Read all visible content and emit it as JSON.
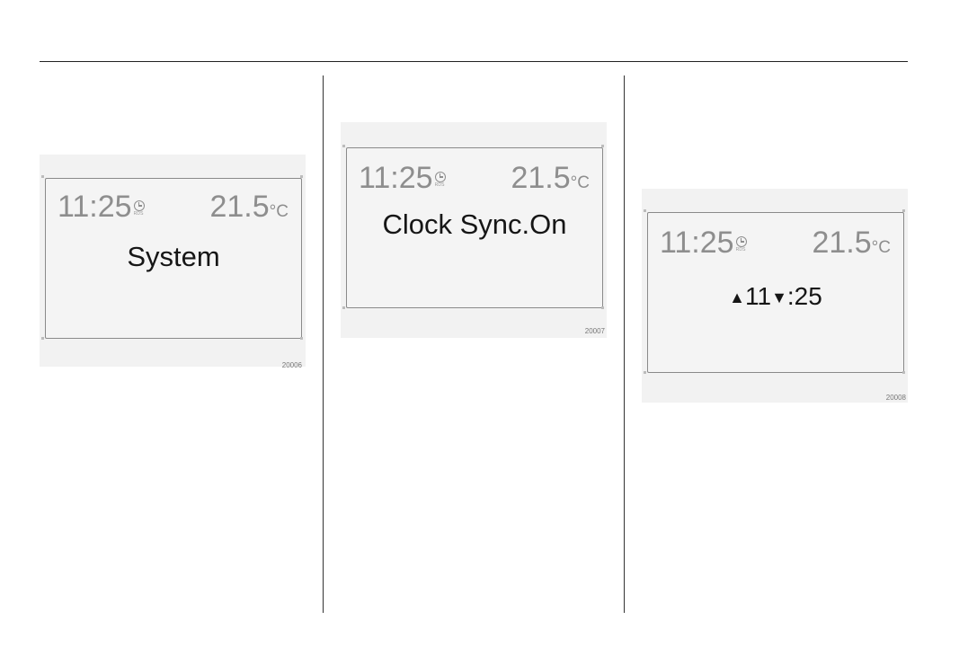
{
  "panels": [
    {
      "time": "11:25",
      "temperature": "21.5",
      "unit": "°C",
      "message": "System",
      "figure_number": "20006"
    },
    {
      "time": "11:25",
      "temperature": "21.5",
      "unit": "°C",
      "message": "Clock Sync.On",
      "figure_number": "20007"
    },
    {
      "time": "11:25",
      "temperature": "21.5",
      "unit": "°C",
      "hours": "11",
      "separator": ":",
      "minutes": "25",
      "up_arrow": "▲",
      "down_arrow": "▼",
      "figure_number": "20008"
    }
  ],
  "icons": {
    "clock": "clock-rds-icon",
    "clock_label": "RDS"
  },
  "colors": {
    "display_text": "#8e8e8e",
    "message_text": "#161616",
    "display_border": "#8a8a8a",
    "display_bg": "#f4f4f4"
  }
}
